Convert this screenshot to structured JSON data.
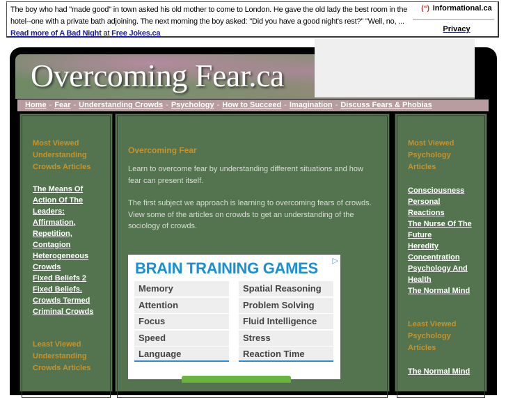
{
  "topbar": {
    "joke_text": "The boy who had \"made good\" in town asked his old mother to come to London. He gave the old lady the best room in the hotel--one with a private bath adjoining. The next morning the boy asked: \"Did you have a good night's rest?\" \"Well, no, ... ",
    "read_more_link": "Read more of A Bad Night",
    "at_text": " at ",
    "source_link": "Free Jokes.ca",
    "brand_icon": "(“) ",
    "brand_label": "Informational.ca",
    "privacy_link": "Privacy"
  },
  "header": {
    "site_title": "Overcoming Fear.ca"
  },
  "nav": {
    "items": [
      "Home",
      "Fear",
      "Understanding Crowds",
      "Psychology",
      "How to Succeed",
      "Imagination",
      "Discuss Fears & Phobias"
    ],
    "separator": "-"
  },
  "left": {
    "most_heading": "Most Viewed Understanding Crowds Articles",
    "most_items": [
      "The Means Of Action Of The Leaders: Affirmation, Repetition, Contagion",
      "Heterogeneous Crowds",
      "Fixed Beliefs 2",
      "Fixed Beliefs. Crowds Termed Criminal Crowds"
    ],
    "least_heading": "Least Viewed Understanding Crowds Articles"
  },
  "main": {
    "title": "Overcoming Fear",
    "paragraph1": "Learn to overcome fear by understanding different situations and how fear can present itself.",
    "paragraph2": "The first subject we approach is learning to overcoming fears of crowds. View some of the articles on crowds to get an understanding of the sociology of crowds."
  },
  "ad": {
    "title": "BRAIN TRAINING GAMES",
    "choices_icon": "▷",
    "left_items": [
      "Memory",
      "Attention",
      "Focus",
      "Speed",
      "Language"
    ],
    "right_items": [
      "Spatial Reasoning",
      "Problem Solving",
      "Fluid Intelligence",
      "Stress",
      "Reaction Time"
    ],
    "accent": "#1a8fd6"
  },
  "right": {
    "most_heading": "Most Viewed Psychology Articles",
    "most_items": [
      "Consciousness",
      "Personal Reactions",
      "The Nurse Of The Future",
      "Heredity",
      "Concentration",
      "Psychology And Health",
      "The Normal Mind"
    ],
    "least_heading": "Least Viewed Psychology Articles",
    "least_items": [
      "The Normal Mind"
    ]
  },
  "colors": {
    "panel_green": "#547450",
    "heading_gold": "#c6932a",
    "nav_pink": "#b89ca0"
  }
}
